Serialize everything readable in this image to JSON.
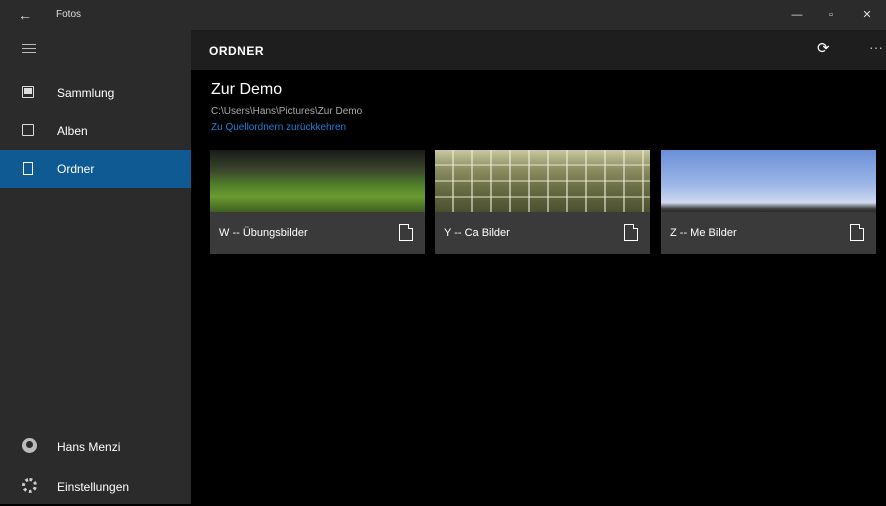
{
  "window": {
    "title": "Fotos",
    "back_glyph": "←",
    "minimize_glyph": "—",
    "maximize_glyph": "▫",
    "close_glyph": "✕"
  },
  "sidebar": {
    "items": [
      {
        "label": "Sammlung",
        "icon": "collection-icon"
      },
      {
        "label": "Alben",
        "icon": "album-icon"
      },
      {
        "label": "Ordner",
        "icon": "folder-icon",
        "active": true
      }
    ],
    "user_name": "Hans Menzi",
    "settings_label": "Einstellungen"
  },
  "header": {
    "title": "ORDNER",
    "refresh_glyph": "⟳",
    "more_glyph": "···"
  },
  "main": {
    "folder_title": "Zur Demo",
    "folder_path": "C:\\Users\\Hans\\Pictures\\Zur Demo",
    "back_link": "Zu Quellordnern zurückkehren",
    "tiles": [
      {
        "label": "W -- Übungsbilder"
      },
      {
        "label": "Y -- Ca Bilder"
      },
      {
        "label": "Z -- Me Bilder"
      }
    ]
  },
  "colors": {
    "accent": "#0f5a92",
    "link": "#1e7fd4",
    "sidebar_bg": "#2b2b2b",
    "content_bg": "#000000"
  }
}
